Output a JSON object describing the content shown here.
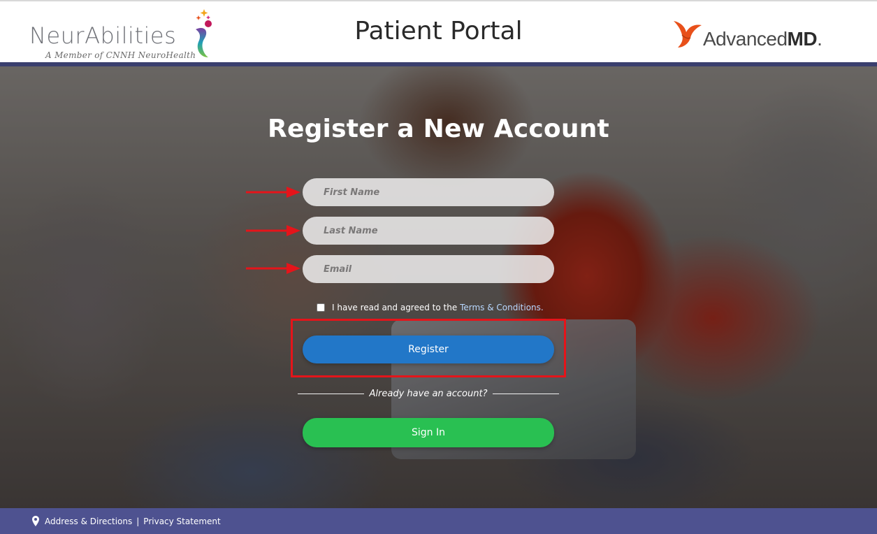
{
  "header": {
    "brand_name": "NeurAbilities",
    "brand_subtitle": "A Member of CNNH NeuroHealth",
    "title": "Patient Portal",
    "partner_logo_regular": "Advanced",
    "partner_logo_bold": "MD",
    "partner_logo_mark": "."
  },
  "form": {
    "title": "Register a New Account",
    "first_name_placeholder": "First Name",
    "last_name_placeholder": "Last Name",
    "email_placeholder": "Email",
    "terms_prefix": "I have read and agreed to the",
    "terms_link": "Terms & Conditions.",
    "register_label": "Register",
    "divider_text": "Already have an account?",
    "signin_label": "Sign In"
  },
  "footer": {
    "address_link": "Address & Directions",
    "separator": "|",
    "privacy_link": "Privacy Statement"
  },
  "colors": {
    "header_rule": "#3a3f6e",
    "register_button": "#2277c8",
    "signin_button": "#29c052",
    "footer": "#4e5290",
    "annotation_red": "#e5141a",
    "partner_orange": "#e8501a"
  }
}
